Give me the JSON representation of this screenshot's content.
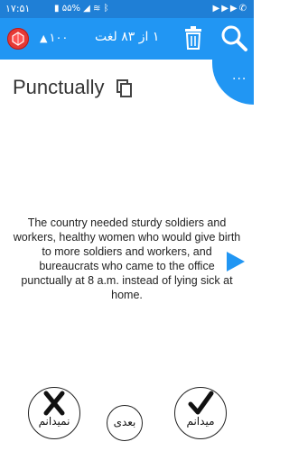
{
  "status_bar": {
    "time": "۱۷:۵۱",
    "battery": "۵۵%",
    "indicators": [
      "signal-icon",
      "wifi-icon",
      "bluetooth-icon",
      "youtube-icon",
      "whatsapp-icon"
    ]
  },
  "app_bar": {
    "gem_icon": "red-gem-icon",
    "score": "۱۰۰",
    "counter": "۱ از ۸۳ لغت",
    "trash_icon": "trash-icon",
    "search_icon": "search-icon",
    "color": "#2196f3"
  },
  "menu_fab": {
    "label": "..."
  },
  "card": {
    "word": "Punctually",
    "copy_icon": "copy-icon",
    "definition": "The country needed sturdy soldiers and workers, healthy women who would give birth to more soldiers and workers, and bureaucrats who came to the office punctually at 8 a.m. instead of lying sick at home.",
    "next_icon": "play-arrow-icon"
  },
  "actions": {
    "dont_know": "نمیدانم",
    "next": "بعدی",
    "know": "میدانم"
  }
}
